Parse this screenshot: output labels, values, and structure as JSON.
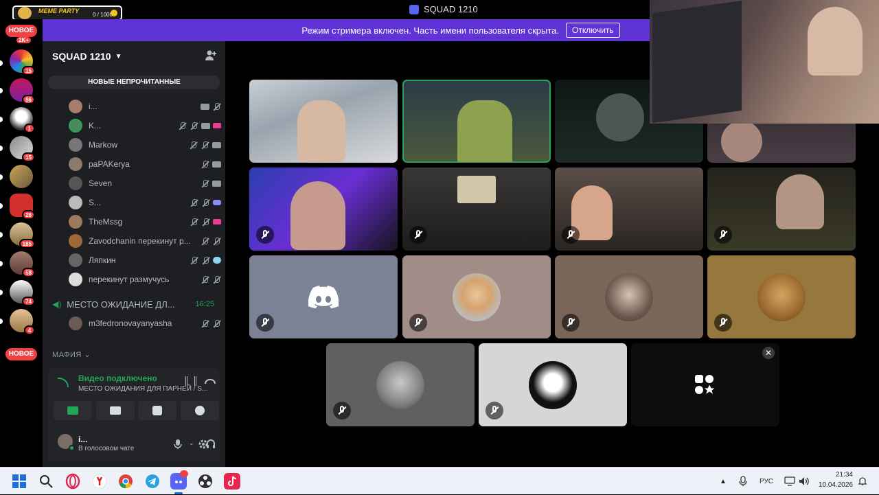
{
  "window": {
    "title": "SQUAD 1210"
  },
  "overlay": {
    "meme_party": "MEME PARTY",
    "counter": "0 / 1000"
  },
  "banner": {
    "text": "Режим стримера включен. Часть имени пользователя скрыта.",
    "button": "Отключить"
  },
  "rail": {
    "new_top": "НОВОЕ",
    "new_bottom": "НОВОЕ",
    "top_badge": "2K+",
    "servers": [
      {
        "badge": "15",
        "color": "#ffffff"
      },
      {
        "badge": "86",
        "color": "#c2185b"
      },
      {
        "badge": "1",
        "color": "#e8e8e8"
      },
      {
        "badge": "15",
        "color": "#b0b0b0"
      },
      {
        "badge": "",
        "color": "#c9a35b"
      },
      {
        "badge": "26",
        "color": "#d32f2f"
      },
      {
        "badge": "185",
        "color": "#d9c29a"
      },
      {
        "badge": "58",
        "color": "#a17a6c"
      },
      {
        "badge": "74",
        "color": "#d8d8d8"
      },
      {
        "badge": "4",
        "color": "#e3c193"
      }
    ]
  },
  "sidebar": {
    "server_name": "SQUAD 1210",
    "new_unread": "НОВЫЕ НЕПРОЧИТАННЫЕ",
    "voice_users": [
      {
        "name": "i...",
        "icons": [
          "cam",
          "x"
        ]
      },
      {
        "name": "K...",
        "icons": [
          "mic",
          "mic",
          "cam",
          "live"
        ]
      },
      {
        "name": "Markow",
        "icons": [
          "mic",
          "mic",
          "cam"
        ]
      },
      {
        "name": "paPAKerya",
        "icons": [
          "mic",
          "cam"
        ]
      },
      {
        "name": "Seven",
        "icons": [
          "mic",
          "cam"
        ]
      },
      {
        "name": "S...",
        "icons": [
          "mic",
          "mic",
          "game"
        ]
      },
      {
        "name": "TheMssg",
        "icons": [
          "mic",
          "mic",
          "live"
        ]
      },
      {
        "name": "Zavodchanin перекинут р...",
        "icons": [
          "mic",
          "mic"
        ]
      },
      {
        "name": "Ляпкин",
        "icons": [
          "mic",
          "mic",
          "chat"
        ]
      },
      {
        "name": "перекинут размучусь",
        "icons": [
          "mic",
          "mic"
        ]
      }
    ],
    "waiting_channel": {
      "name": "МЕСТО ОЖИДАНИЕ ДЛ...",
      "time": "16:25"
    },
    "waiting_users": [
      {
        "name": "m3fedronovayanyasha",
        "icons": [
          "mic",
          "mic"
        ]
      }
    ],
    "category": "МАФИЯ"
  },
  "voice_panel": {
    "status": "Видео подключено",
    "channel": "МЕСТО ОЖИДАНИЯ ДЛЯ ПАРНЕЙ / S..."
  },
  "user_panel": {
    "name": "i...",
    "status": "В голосовом чате"
  },
  "taskbar": {
    "lang": "РУС",
    "time": "21:34",
    "date": "10.04.2026"
  },
  "colors": {
    "accent": "#5865f2",
    "banner": "#5f33d6",
    "online": "#23a55a",
    "badge": "#f23f43"
  }
}
